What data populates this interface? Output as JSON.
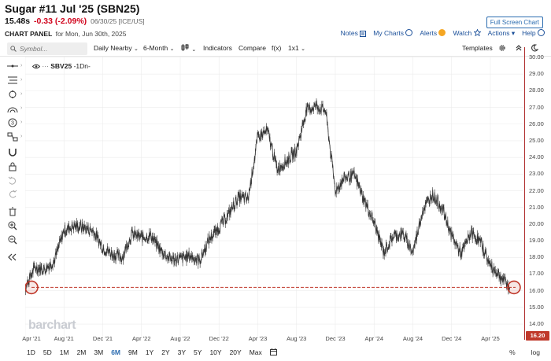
{
  "header": {
    "title": "Sugar #11 Jul '25 (SBN25)",
    "last_price": "15.48s",
    "change": "-0.33 (-2.09%)",
    "date_exchange": "06/30/25 [ICE/US]",
    "fullscreen_label": "Full Screen Chart",
    "panel_title": "CHART PANEL",
    "panel_date": "for Mon, Jun 30th, 2025"
  },
  "panel_links": {
    "notes": "Notes",
    "my_charts": "My Charts",
    "alerts": "Alerts",
    "watch": "Watch",
    "actions": "Actions",
    "help": "Help"
  },
  "toolbar": {
    "symbol_placeholder": "Symbol...",
    "interval": "Daily Nearby",
    "range": "6-Month",
    "indicators": "Indicators",
    "compare": "Compare",
    "fx": "f(x)",
    "layout": "1x1",
    "templates": "Templates"
  },
  "chart_label": {
    "symbol": "SBV25",
    "interval": "-1Dn-"
  },
  "watermark": "barchart",
  "current_price_tag": "16.20",
  "chart_data": {
    "type": "line",
    "title": "",
    "series": [
      {
        "values_by_month": [
          [
            "2021-03",
            15.2
          ],
          [
            "2021-04",
            16.2
          ],
          [
            "2021-05",
            17.4
          ],
          [
            "2021-06",
            17.3
          ],
          [
            "2021-07",
            17.8
          ],
          [
            "2021-08",
            19.6
          ],
          [
            "2021-09",
            19.9
          ],
          [
            "2021-10",
            19.8
          ],
          [
            "2021-11",
            19.6
          ],
          [
            "2021-12",
            18.6
          ],
          [
            "2022-01",
            18.2
          ],
          [
            "2022-02",
            18.0
          ],
          [
            "2022-03",
            19.4
          ],
          [
            "2022-04",
            19.2
          ],
          [
            "2022-05",
            19.3
          ],
          [
            "2022-06",
            18.4
          ],
          [
            "2022-07",
            17.9
          ],
          [
            "2022-08",
            17.9
          ],
          [
            "2022-09",
            18.1
          ],
          [
            "2022-10",
            17.8
          ],
          [
            "2022-11",
            19.1
          ],
          [
            "2022-12",
            19.8
          ],
          [
            "2023-01",
            20.6
          ],
          [
            "2023-02",
            21.6
          ],
          [
            "2023-03",
            21.5
          ],
          [
            "2023-04",
            25.2
          ],
          [
            "2023-05",
            25.6
          ],
          [
            "2023-06",
            23.3
          ],
          [
            "2023-07",
            23.8
          ],
          [
            "2023-08",
            24.4
          ],
          [
            "2023-09",
            26.8
          ],
          [
            "2023-10",
            27.1
          ],
          [
            "2023-11",
            26.8
          ],
          [
            "2023-12",
            22.0
          ],
          [
            "2024-01",
            22.8
          ],
          [
            "2024-02",
            22.9
          ],
          [
            "2024-03",
            21.4
          ],
          [
            "2024-04",
            20.1
          ],
          [
            "2024-05",
            18.3
          ],
          [
            "2024-06",
            19.3
          ],
          [
            "2024-07",
            19.4
          ],
          [
            "2024-08",
            18.3
          ],
          [
            "2024-09",
            20.8
          ],
          [
            "2024-10",
            21.8
          ],
          [
            "2024-11",
            21.0
          ],
          [
            "2024-12",
            19.3
          ],
          [
            "2025-01",
            18.2
          ],
          [
            "2025-02",
            19.5
          ],
          [
            "2025-03",
            18.9
          ],
          [
            "2025-04",
            17.5
          ],
          [
            "2025-05",
            16.9
          ],
          [
            "2025-06",
            16.2
          ]
        ]
      }
    ],
    "y_ticks": [
      "30.00",
      "29.00",
      "28.00",
      "27.00",
      "26.00",
      "25.00",
      "24.00",
      "23.00",
      "22.00",
      "21.00",
      "20.00",
      "19.00",
      "18.00",
      "17.00",
      "16.00",
      "15.00",
      "14.00"
    ],
    "x_ticks": [
      "Apr '21",
      "Aug '21",
      "Dec '21",
      "Apr '22",
      "Aug '22",
      "Dec '22",
      "Apr '23",
      "Aug '23",
      "Dec '23",
      "Apr '24",
      "Aug '24",
      "Dec '24",
      "Apr '25"
    ],
    "ylim": [
      14,
      30.5
    ],
    "reference_line": 16.2,
    "grid": true
  },
  "periods": [
    "1D",
    "5D",
    "1M",
    "2M",
    "3M",
    "6M",
    "9M",
    "1Y",
    "2Y",
    "3Y",
    "5Y",
    "10Y",
    "20Y",
    "Max"
  ],
  "active_period": "6M",
  "bottom_right": {
    "percent": "%",
    "log": "log"
  },
  "colors": {
    "accent": "#2b6cb0",
    "negative": "#d0021b",
    "price_line": "#c0392b",
    "grid": "#ececec"
  }
}
